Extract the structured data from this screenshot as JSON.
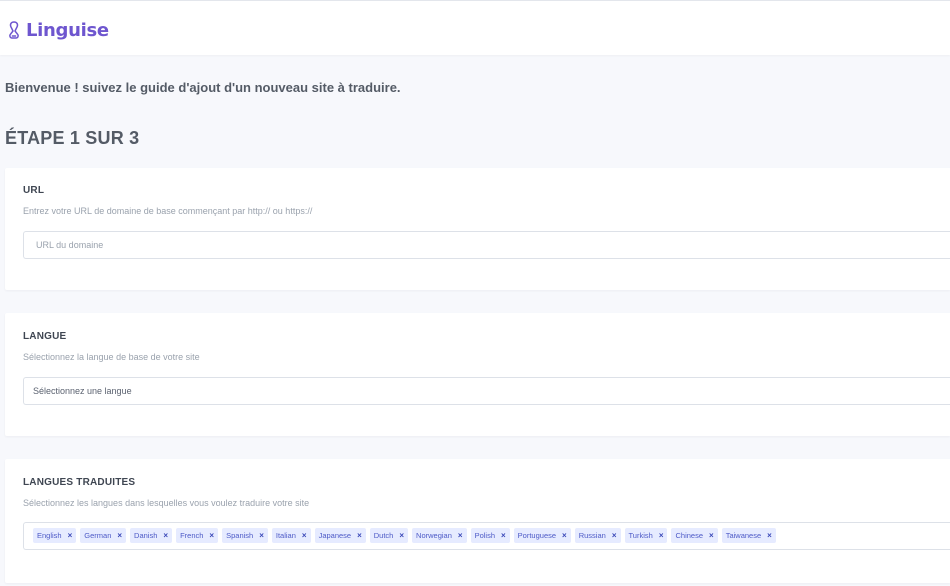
{
  "brand": {
    "name": "Linguise",
    "color": "#6e56cf",
    "icon": "linguise-logo-icon"
  },
  "page": {
    "welcome": "Bienvenue ! suivez le guide d'ajout d'un nouveau site à traduire.",
    "step": "ÉTAPE 1 SUR 3"
  },
  "url_section": {
    "title": "URL",
    "help": "Entrez votre URL de domaine de base commençant par http:// ou https://",
    "placeholder": "URL du domaine",
    "value": ""
  },
  "language_section": {
    "title": "LANGUE",
    "help": "Sélectionnez la langue de base de votre site",
    "selected": "Sélectionnez une langue"
  },
  "translated_section": {
    "title": "LANGUES TRADUITES",
    "help": "Sélectionnez les langues dans lesquelles vous voulez traduire votre site",
    "remove_symbol": "×",
    "tags": [
      "English",
      "German",
      "Danish",
      "French",
      "Spanish",
      "Italian",
      "Japanese",
      "Dutch",
      "Norwegian",
      "Polish",
      "Portuguese",
      "Russian",
      "Turkish",
      "Chinese",
      "Taiwanese"
    ],
    "tag_bg": "#e6ebff",
    "tag_text": "#4d5ac7"
  }
}
